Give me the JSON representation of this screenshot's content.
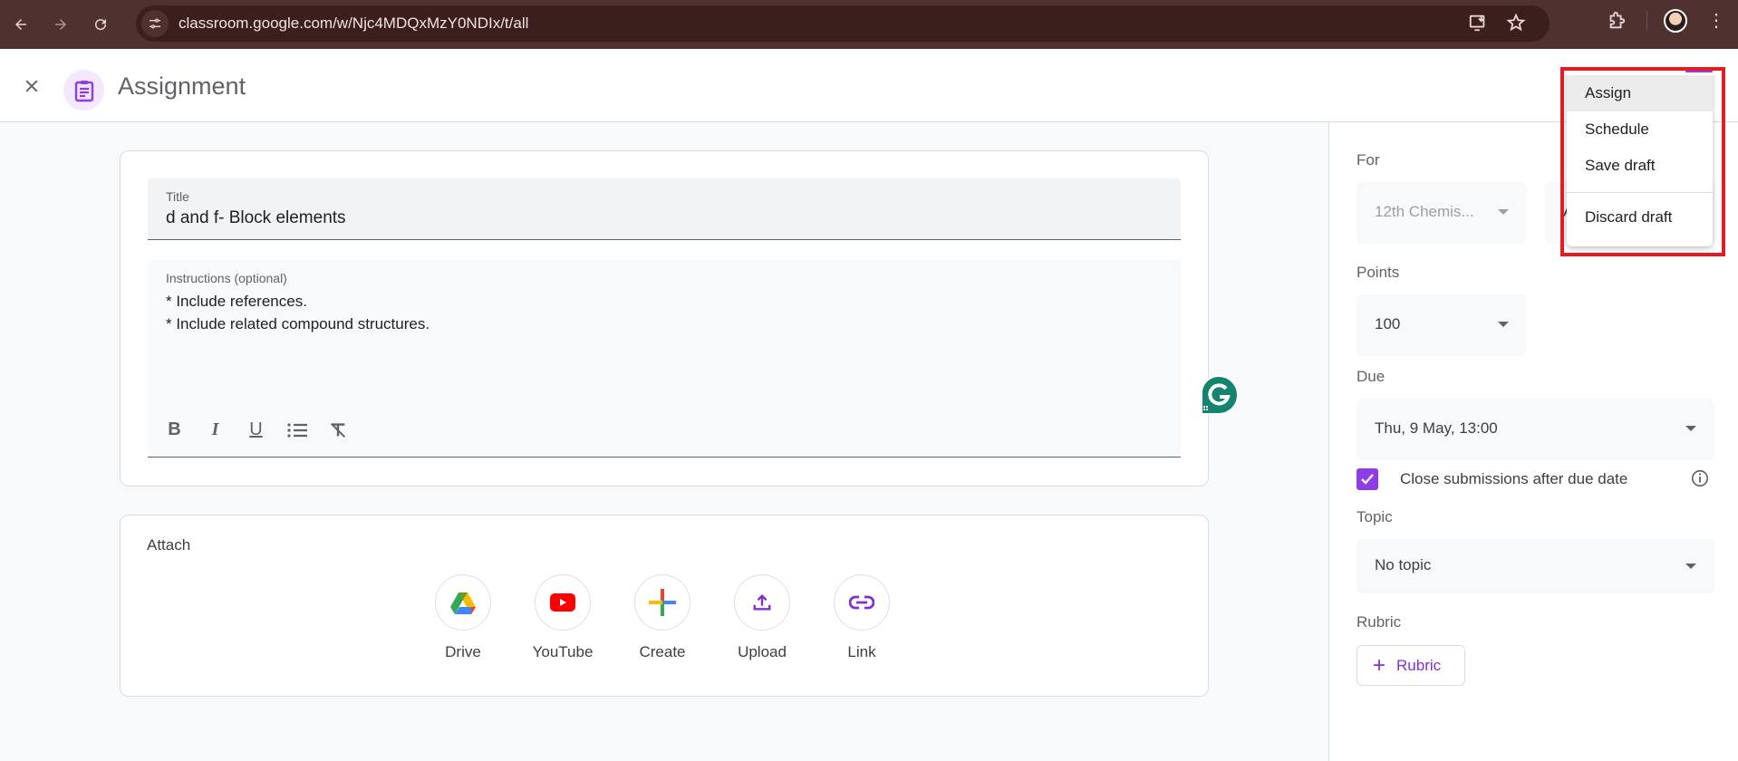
{
  "browser": {
    "url": "classroom.google.com/w/Njc4MDQxMzY0NDIx/t/all",
    "icons": [
      "back-arrow-icon",
      "forward-arrow-icon",
      "reload-icon",
      "site-info-icon",
      "install-app-icon",
      "bookmark-star-icon",
      "extensions-icon",
      "profile-avatar",
      "more-menu-icon"
    ]
  },
  "header": {
    "title": "Assignment"
  },
  "form": {
    "title_label": "Title",
    "title_value": "d and f- Block elements",
    "instructions_label": "Instructions (optional)",
    "instructions_lines": [
      "* Include references.",
      "* Include related compound structures."
    ],
    "toolbar": [
      "Bold",
      "Italic",
      "Underline",
      "Bulleted list",
      "Remove formatting"
    ]
  },
  "attach": {
    "label": "Attach",
    "items": [
      {
        "label": "Drive",
        "icon": "google-drive-icon"
      },
      {
        "label": "YouTube",
        "icon": "youtube-icon"
      },
      {
        "label": "Create",
        "icon": "create-plus-icon"
      },
      {
        "label": "Upload",
        "icon": "upload-icon"
      },
      {
        "label": "Link",
        "icon": "link-icon"
      }
    ]
  },
  "settings": {
    "for_label": "For",
    "for_class": "12th Chemis...",
    "for_students_partial": "A",
    "points_label": "Points",
    "points_value": "100",
    "due_label": "Due",
    "due_value": "Thu, 9 May, 13:00",
    "close_submissions_label": "Close submissions after due date",
    "close_submissions_checked": true,
    "topic_label": "Topic",
    "topic_value": "No topic",
    "rubric_label": "Rubric",
    "rubric_button": "Rubric"
  },
  "menu": {
    "items": [
      "Assign",
      "Schedule",
      "Save draft"
    ],
    "discard": "Discard draft",
    "highlighted": "Assign"
  },
  "colors": {
    "accent": "#8e3ce8",
    "chrome": "#4f3230",
    "highlight_box": "#e31b23",
    "grammarly": "#15846e"
  }
}
